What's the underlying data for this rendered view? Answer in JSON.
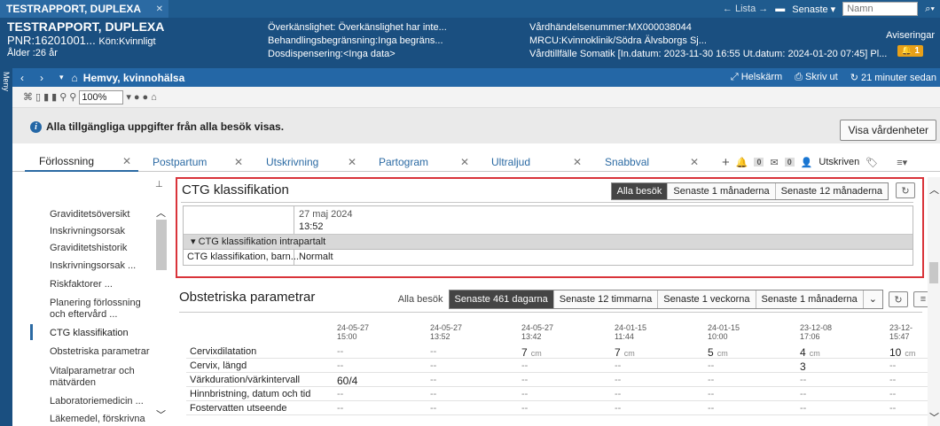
{
  "topbar": {
    "patient_tab": "TESTRAPPORT, DUPLEXA",
    "lista": "← Lista →",
    "senaste": "Senaste ▾",
    "name_placeholder": "Namn"
  },
  "header": {
    "name": "TESTRAPPORT, DUPLEXA",
    "pnr": "PNR:16201001...",
    "kon": "Kön:Kvinnligt",
    "alder": "Ålder :26 år",
    "col1": [
      "Överkänslighet: Överkänslighet har inte...",
      "Behandlingsbegränsning:Inga begräns...",
      "Dosdispensering:<Inga data>"
    ],
    "col2": [
      "Vårdhändelsenummer:MX000038044",
      "MRCU:Kvinnoklinik/Södra Älvsborgs Sj...",
      "Vårdtillfälle Somatik [In.datum: 2023-11-30 16:55 Ut.datum: 2024-01-20 07:45] Pl..."
    ],
    "aviseringar": "Aviseringar",
    "avis_count": "1"
  },
  "meny": "Meny",
  "nav": {
    "title": "Hemvy, kvinnohälsa",
    "helskarm": "Helskärm",
    "skrivut": "Skriv ut",
    "updated": "21 minuter sedan"
  },
  "toolbar": {
    "zoom": "100%"
  },
  "info": {
    "message": "Alla tillgängliga uppgifter från alla besök visas.",
    "button": "Visa vårdenheter"
  },
  "tabs": [
    "Förlossning",
    "Postpartum",
    "Utskrivning",
    "Partogram",
    "Ultraljud",
    "Snabbval"
  ],
  "tabicons": {
    "c1": "0",
    "c2": "0",
    "status": "Utskriven"
  },
  "leftnav": [
    "Graviditetsöversikt",
    "Inskrivningsorsak",
    "Graviditetshistorik",
    "Inskrivningsorsak ...",
    "Riskfaktorer ...",
    "Planering förlossning",
    "och eftervård ...",
    "CTG klassifikation",
    "Obstetriska parametrar",
    "Vitalparametrar och",
    "mätvärden",
    "Laboratoriemedicin ...",
    "Läkemedel, förskrivna"
  ],
  "ctg": {
    "title": "CTG klassifikation",
    "segments": [
      "Alla besök",
      "Senaste 1 månaderna",
      "Senaste 12 månaderna"
    ],
    "date": "27 maj 2024",
    "time": "13:52",
    "group": "▾ CTG klassifikation intrapartalt",
    "row_label": "CTG klassifikation, barn...",
    "row_value": "Normalt"
  },
  "obs": {
    "title": "Obstetriska parametrar",
    "alla": "Alla besök",
    "segments": [
      "Senaste 461 dagarna",
      "Senaste 12 timmarna",
      "Senaste 1 veckorna",
      "Senaste 1 månaderna"
    ],
    "dates": [
      [
        "24-05-27",
        "15:00"
      ],
      [
        "24-05-27",
        "13:52"
      ],
      [
        "24-05-27",
        "13:42"
      ],
      [
        "24-01-15",
        "11:44"
      ],
      [
        "24-01-15",
        "10:00"
      ],
      [
        "23-12-08",
        "17:06"
      ],
      [
        "23-12-",
        "15:47"
      ]
    ],
    "rows": [
      {
        "label": "Cervixdilatation",
        "vals": [
          "--",
          "--",
          "7",
          "7",
          "5",
          "4",
          "10"
        ],
        "units": [
          "",
          "",
          "cm",
          "cm",
          "cm",
          "cm",
          "cm"
        ]
      },
      {
        "label": "Cervix, längd",
        "vals": [
          "--",
          "--",
          "--",
          "--",
          "--",
          "3",
          "--"
        ],
        "units": [
          "",
          "",
          "",
          "",
          "",
          "",
          ""
        ]
      },
      {
        "label": "Värkduration/värkintervall",
        "vals": [
          "60/4",
          "--",
          "--",
          "--",
          "--",
          "--",
          "--"
        ],
        "units": [
          "",
          "",
          "",
          "",
          "",
          "",
          ""
        ]
      },
      {
        "label": "Hinnbristning, datum och tid",
        "vals": [
          "--",
          "--",
          "--",
          "--",
          "--",
          "--",
          "--"
        ],
        "units": [
          "",
          "",
          "",
          "",
          "",
          "",
          ""
        ]
      },
      {
        "label": "Fostervatten utseende",
        "vals": [
          "--",
          "--",
          "--",
          "--",
          "--",
          "--",
          "--"
        ],
        "units": [
          "",
          "",
          "",
          "",
          "",
          "",
          ""
        ]
      }
    ]
  }
}
